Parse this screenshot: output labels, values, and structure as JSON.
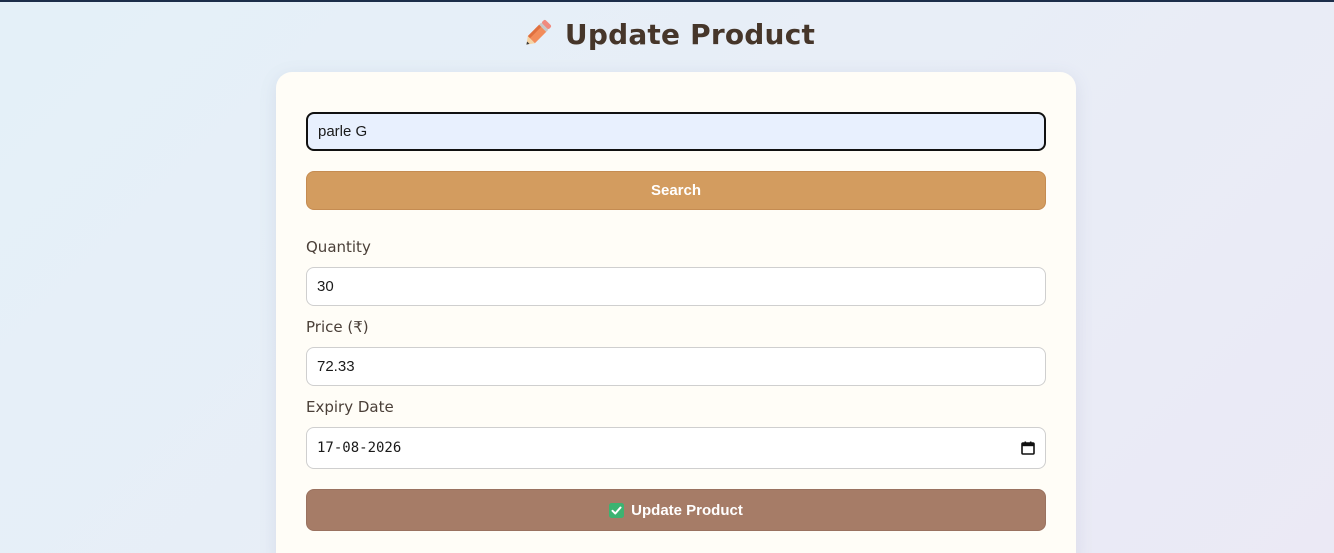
{
  "header": {
    "title": "Update Product",
    "icon": "pencil-icon"
  },
  "search": {
    "value": "parle G",
    "button_label": "Search"
  },
  "form": {
    "quantity": {
      "label": "Quantity",
      "value": "30"
    },
    "price": {
      "label": "Price (₹)",
      "value": "72.33"
    },
    "expiry": {
      "label": "Expiry Date",
      "value": "17-08-2026",
      "icon": "calendar-icon"
    },
    "submit_label": "Update Product",
    "submit_icon": "check-mark-icon"
  },
  "colors": {
    "search_button": "#d39c5f",
    "update_button": "#a67c67",
    "title_text": "#46362a",
    "check_icon": "#3cb371"
  }
}
